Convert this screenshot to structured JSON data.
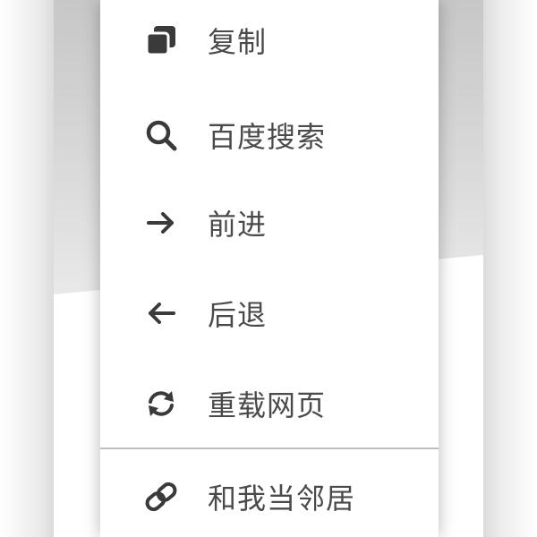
{
  "menu": {
    "items": [
      {
        "label": "复制",
        "icon": "copy-icon"
      },
      {
        "label": "百度搜索",
        "icon": "search-icon"
      },
      {
        "label": "前进",
        "icon": "arrow-right-icon"
      },
      {
        "label": "后退",
        "icon": "arrow-left-icon"
      },
      {
        "label": "重载网页",
        "icon": "reload-icon"
      },
      {
        "label": "和我当邻居",
        "icon": "link-icon"
      }
    ]
  },
  "colors": {
    "text": "#4a4a4a",
    "icon": "#3a3a3a",
    "divider": "#bdbdbd",
    "menu_background": "#ffffff"
  }
}
